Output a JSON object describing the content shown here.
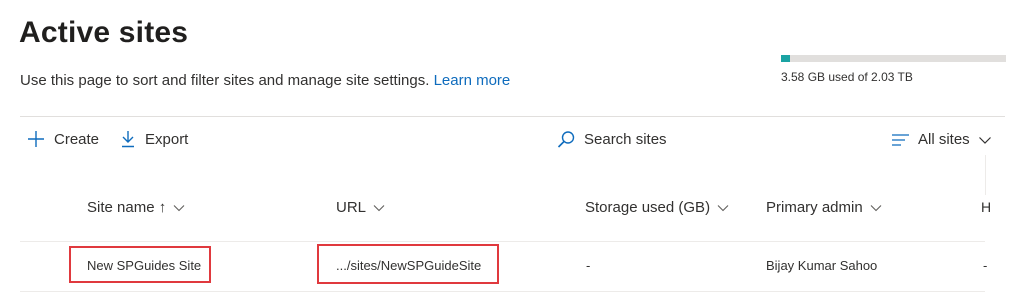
{
  "header": {
    "title": "Active sites",
    "description": "Use this page to sort and filter sites and manage site settings.",
    "learn_more": "Learn more"
  },
  "storage": {
    "used_text": "3.58 GB used of 2.03 TB",
    "used_fraction": 0.04,
    "bar_color": "#1aa3a3"
  },
  "toolbar": {
    "create_label": "Create",
    "create_icon": "plus-icon",
    "export_label": "Export",
    "export_icon": "download-arrow-icon",
    "search_placeholder": "Search sites",
    "search_icon": "search-icon",
    "view_label": "All sites",
    "view_icon": "list-filter-icon"
  },
  "table": {
    "columns": [
      {
        "label": "Site name ↑"
      },
      {
        "label": "URL"
      },
      {
        "label": "Storage used (GB)"
      },
      {
        "label": "Primary admin"
      },
      {
        "label": "H"
      }
    ],
    "rows": [
      {
        "site_name": "New SPGuides Site",
        "url": ".../sites/NewSPGuideSite",
        "storage": "-",
        "admin": "Bijay Kumar Sahoo",
        "extra": "-"
      }
    ]
  },
  "highlight_color": "#e0393e"
}
